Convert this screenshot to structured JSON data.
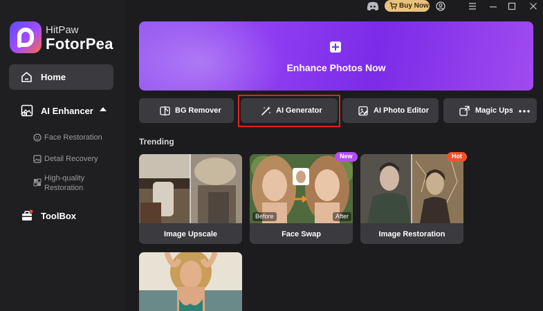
{
  "brand": {
    "line1": "HitPaw",
    "line2": "FotorPea"
  },
  "sidebar": {
    "home": "Home",
    "ai_enhancer": "AI Enhancer",
    "sub_items": [
      "Face Restoration",
      "Detail Recovery",
      "High-quality Restoration"
    ],
    "toolbox": "ToolBox"
  },
  "titlebar": {
    "buy_now": "Buy Now"
  },
  "banner": {
    "label": "Enhance Photos Now"
  },
  "tools": [
    "BG Remover",
    "AI Generator",
    "AI Photo Editor",
    "Magic Upsc"
  ],
  "trending": {
    "heading": "Trending",
    "cards": [
      {
        "title": "Image Upscale"
      },
      {
        "title": "Face Swap",
        "badge": "New",
        "before": "Before",
        "after": "After"
      },
      {
        "title": "Image Restoration",
        "badge": "Hot"
      },
      {
        "title": ""
      }
    ]
  },
  "colors": {
    "accent": "#8d3cf1",
    "highlight": "#e0231f",
    "new_badge": "#b44cf5",
    "hot_badge": "#f4512b",
    "buy_now": "#e9c27e"
  }
}
